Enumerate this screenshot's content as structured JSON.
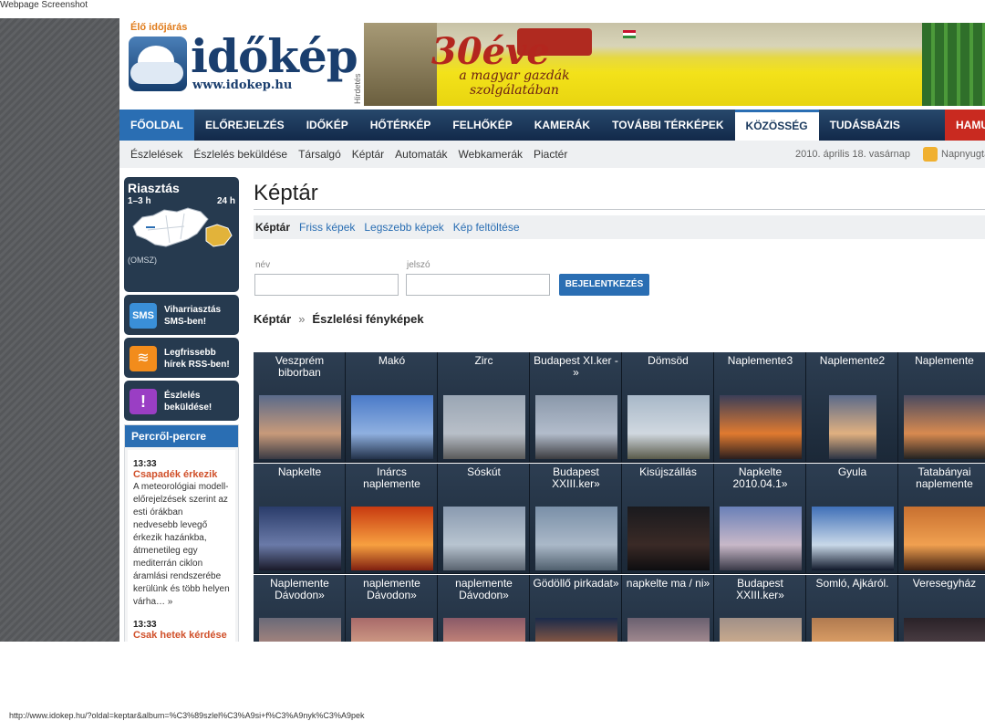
{
  "window": {
    "caption": "Webpage Screenshot",
    "status_url": "http://www.idokep.hu/?oldal=keptar&album=%C3%89szlel%C3%A9si+f%C3%A9nyk%C3%A9pek"
  },
  "header": {
    "live_label": "Élő időjárás",
    "logo_text": "időkép",
    "logo_url": "www.idokep.hu",
    "ad_label": "Hirdetés",
    "banner": {
      "years": "30éve",
      "tagline": "a magyar gazdák szolgálatában"
    }
  },
  "mainnav": [
    "FŐOLDAL",
    "ELŐREJELZÉS",
    "IDŐKÉP",
    "HŐTÉRKÉP",
    "FELHŐKÉP",
    "KAMERÁK",
    "TOVÁBBI TÉRKÉPEK",
    "KÖZÖSSÉG",
    "TUDÁSBÁZIS",
    "HAMU"
  ],
  "subnav": {
    "items": [
      "Észlelések",
      "Észlelés beküldése",
      "Társalgó",
      "Képtár",
      "Automaták",
      "Webkamerák",
      "Piactér"
    ],
    "date": "2010. április 18. vasárnap",
    "sunset": "Napnyugta"
  },
  "sidebar": {
    "alert_title": "Riasztás",
    "alert_range1": "1–3 h",
    "alert_range2": "24 h",
    "alert_source": "(OMSZ)",
    "buttons": [
      {
        "icon": "sms-icon",
        "label": "Viharriasztás SMS-ben!",
        "glyph": "SMS"
      },
      {
        "icon": "rss-icon",
        "label": "Legfrissebb hírek RSS-ben!",
        "glyph": "≋"
      },
      {
        "icon": "exclamation-icon",
        "label": "Észlelés beküldése!",
        "glyph": "!"
      }
    ],
    "news_title": "Percről-percre",
    "news": [
      {
        "time": "13:33",
        "title": "Csapadék érkezik",
        "text": "A meteorológiai modell-előrejelzések szerint az esti órákban nedvesebb levegő érkezik hazánkba, átmenetileg egy mediterrán ciklon áramlási rendszerébe kerülünk és több helyen várha… »"
      },
      {
        "time": "13:33",
        "title": "Csak hetek kérdése az egész",
        "text": ""
      }
    ]
  },
  "content": {
    "title": "Képtár",
    "tabs": [
      "Képtár",
      "Friss képek",
      "Legszebb képek",
      "Kép feltöltése"
    ],
    "login": {
      "name_label": "név",
      "password_label": "jelszó",
      "button": "BEJELENTKEZÉS"
    },
    "breadcrumb": [
      "Képtár",
      "»",
      "Észlelési fényképek"
    ],
    "gallery": [
      {
        "caption": "Veszprém biborban",
        "colors": [
          "#5a6a8a",
          "#c89a7a",
          "#3a3a44"
        ],
        "w": 90
      },
      {
        "caption": "Makó",
        "colors": [
          "#4a7ac8",
          "#8fb0e0",
          "#23324a"
        ],
        "w": 90
      },
      {
        "caption": "Zirc",
        "colors": [
          "#9aa6b4",
          "#b8bfc8",
          "#5a5a5a"
        ],
        "w": 90
      },
      {
        "caption": "Budapest XI.ker - »",
        "colors": [
          "#8a98aa",
          "#b2bccb",
          "#3c3c40"
        ],
        "w": 90
      },
      {
        "caption": "Dömsöd",
        "colors": [
          "#a8b8c8",
          "#d0d8e0",
          "#5a5a4a"
        ],
        "w": 90
      },
      {
        "caption": "Naplemente3",
        "colors": [
          "#3b3e58",
          "#e07a30",
          "#2a1e1e"
        ],
        "w": 90
      },
      {
        "caption": "Naplemente2",
        "colors": [
          "#5a6a8a",
          "#e0b080",
          "#2c3444"
        ],
        "w": 52
      },
      {
        "caption": "Naplemente",
        "colors": [
          "#4a4a60",
          "#d88a50",
          "#222"
        ],
        "w": 90
      },
      {
        "caption": "Napkelte",
        "colors": [
          "#2a3c6a",
          "#6a7aa8",
          "#1a1a2a"
        ],
        "w": 90
      },
      {
        "caption": "Inárcs naplemente",
        "colors": [
          "#c83a10",
          "#f7a040",
          "#802010"
        ],
        "w": 90
      },
      {
        "caption": "Sóskút",
        "colors": [
          "#8a9ab0",
          "#b8c4d0",
          "#5a6470"
        ],
        "w": 90
      },
      {
        "caption": "Budapest XXIII.ker»",
        "colors": [
          "#7a90a8",
          "#aab8c8",
          "#50606e"
        ],
        "w": 90
      },
      {
        "caption": "Kisújszállás",
        "colors": [
          "#1a1a1e",
          "#3a2a26",
          "#0e0e10"
        ],
        "w": 90
      },
      {
        "caption": "Napkelte 2010.04.1»",
        "colors": [
          "#6a80b8",
          "#c8b8c8",
          "#3a3a48"
        ],
        "w": 90
      },
      {
        "caption": "Gyula",
        "colors": [
          "#4070b8",
          "#c8d8e8",
          "#10182a"
        ],
        "w": 90
      },
      {
        "caption": "Tatabányai naplemente",
        "colors": [
          "#c87030",
          "#f0a050",
          "#402010"
        ],
        "w": 90
      },
      {
        "caption": "Naplemente Dávodon»",
        "colors": [
          "#6a6a78",
          "#c09080",
          "#3a3a40"
        ],
        "w": 90
      },
      {
        "caption": "naplemente Dávodon»",
        "colors": [
          "#a86a6a",
          "#e0b090",
          "#6a4040"
        ],
        "w": 90
      },
      {
        "caption": "naplemente Dávodon»",
        "colors": [
          "#8a5a68",
          "#e09880",
          "#4a3038"
        ],
        "w": 90
      },
      {
        "caption": "Gödöllő pirkadat»",
        "colors": [
          "#1a2a4a",
          "#c07040",
          "#101420"
        ],
        "w": 90
      },
      {
        "caption": "napkelte ma / ni»",
        "colors": [
          "#6a6070",
          "#c0a0a0",
          "#3a3038"
        ],
        "w": 90
      },
      {
        "caption": "Budapest XXIII.ker»",
        "colors": [
          "#a09088",
          "#e0b890",
          "#6a5a50"
        ],
        "w": 90
      },
      {
        "caption": "Somló, Ajkáról.",
        "colors": [
          "#b07a50",
          "#f0b070",
          "#6a4a30"
        ],
        "w": 90
      },
      {
        "caption": "Veresegyház",
        "colors": [
          "#2a2228",
          "#5a4a50",
          "#141014"
        ],
        "w": 90
      }
    ]
  },
  "colors": {
    "accent": "#2a6eb3",
    "nav_dark": "#12294a",
    "news_red": "#d0502a",
    "hot": "#c92a20"
  }
}
